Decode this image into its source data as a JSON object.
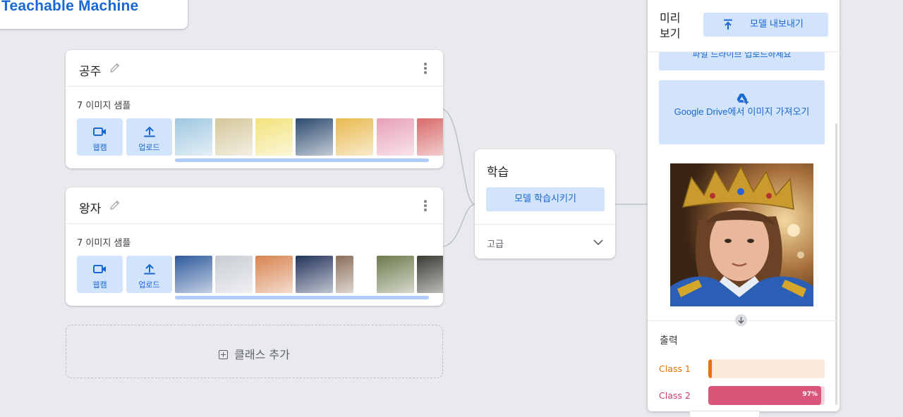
{
  "app": {
    "title": "Teachable Machine"
  },
  "classes": [
    {
      "name": "공주",
      "sample_count": "7 이미지 샘플",
      "webcam_label": "웹캠",
      "upload_label": "업로드",
      "thumb_colors": [
        "#9ec7e0",
        "#d4c79a",
        "#f2e27a",
        "#2c4a6e",
        "#e8b94e",
        "#e7a0b6",
        "#d86a6a"
      ]
    },
    {
      "name": "왕자",
      "sample_count": "7 이미지 샘플",
      "webcam_label": "웹캠",
      "upload_label": "업로드",
      "thumb_colors": [
        "#2e5a9c",
        "#c8ccd2",
        "#d8834f",
        "#22325a",
        "#8b6f5a",
        "#6d7a4c",
        "#3b3a33"
      ]
    }
  ],
  "add_class_label": "클래스 추가",
  "training": {
    "title": "학습",
    "train_button": "모델 학습시키기",
    "advanced_label": "고급"
  },
  "preview": {
    "title": "미리\n보기",
    "export_button": "모델 내보내기",
    "gdrive_partial": "파일 드라이브 업로드하세요",
    "gdrive_brand": "Google Drive",
    "gdrive_suffix": "에서 이미지 가져오기",
    "output_title": "출력",
    "results": [
      {
        "name": "Class 1",
        "percent": 3,
        "percent_label": "",
        "label_color": "#e37400",
        "track_color": "#fce8dc",
        "fill_color": "#e8710a"
      },
      {
        "name": "Class 2",
        "percent": 97,
        "percent_label": "97%",
        "label_color": "#d03a6a",
        "track_color": "#fad2df",
        "fill_color": "#d9557a"
      }
    ]
  }
}
